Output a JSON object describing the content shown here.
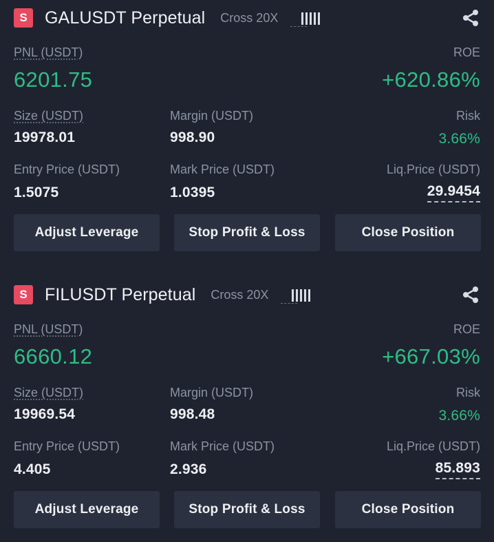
{
  "positions": [
    {
      "badge": "S",
      "symbol": "GALUSDT Perpetual",
      "mode": "Cross 20X",
      "pnl_label": "PNL (USDT)",
      "pnl_value": "6201.75",
      "roe_label": "ROE",
      "roe_value": "+620.86%",
      "size_label": "Size (USDT)",
      "size_value": "19978.01",
      "margin_label": "Margin (USDT)",
      "margin_value": "998.90",
      "risk_label": "Risk",
      "risk_value": "3.66%",
      "entry_label": "Entry Price (USDT)",
      "entry_value": "1.5075",
      "mark_label": "Mark Price (USDT)",
      "mark_value": "1.0395",
      "liq_label": "Liq.Price (USDT)",
      "liq_value": "29.9454",
      "buttons": {
        "adjust": "Adjust Leverage",
        "stop": "Stop Profit & Loss",
        "close": "Close Position"
      }
    },
    {
      "badge": "S",
      "symbol": "FILUSDT Perpetual",
      "mode": "Cross 20X",
      "pnl_label": "PNL (USDT)",
      "pnl_value": "6660.12",
      "roe_label": "ROE",
      "roe_value": "+667.03%",
      "size_label": "Size (USDT)",
      "size_value": "19969.54",
      "margin_label": "Margin (USDT)",
      "margin_value": "998.48",
      "risk_label": "Risk",
      "risk_value": "3.66%",
      "entry_label": "Entry Price (USDT)",
      "entry_value": "4.405",
      "mark_label": "Mark Price (USDT)",
      "mark_value": "2.936",
      "liq_label": "Liq.Price (USDT)",
      "liq_value": "85.893",
      "buttons": {
        "adjust": "Adjust Leverage",
        "stop": "Stop Profit & Loss",
        "close": "Close Position"
      }
    }
  ],
  "colors": {
    "background": "#1f2330",
    "green": "#2ebd85",
    "badge": "#e84a60",
    "button": "#2b3140",
    "label": "#8c93a1"
  },
  "icons": {
    "share": "share-icon",
    "leverage_bars": "signal-bars-icon"
  }
}
